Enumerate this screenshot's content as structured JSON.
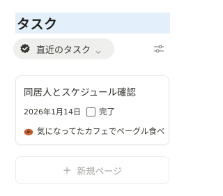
{
  "header": {
    "title": "タスク"
  },
  "view": {
    "label": "直近のタスク",
    "icon": "check-badge-icon"
  },
  "toolbar": {
    "filter_icon": "filter-sliders-icon"
  },
  "cards": [
    {
      "title": "同居人とスケジュール確認",
      "date": "2026年1月14日",
      "done_label": "完了",
      "done": false,
      "note_icon": "bagel-icon",
      "note": "気になってたカフェでベーグル食べ"
    }
  ],
  "new_page": {
    "plus": "+",
    "label": "新規ページ"
  },
  "colors": {
    "title_highlight": "#e3f0fb",
    "tab_background": "#efefed",
    "text": "#37352f",
    "muted": "#a5a4a0"
  }
}
